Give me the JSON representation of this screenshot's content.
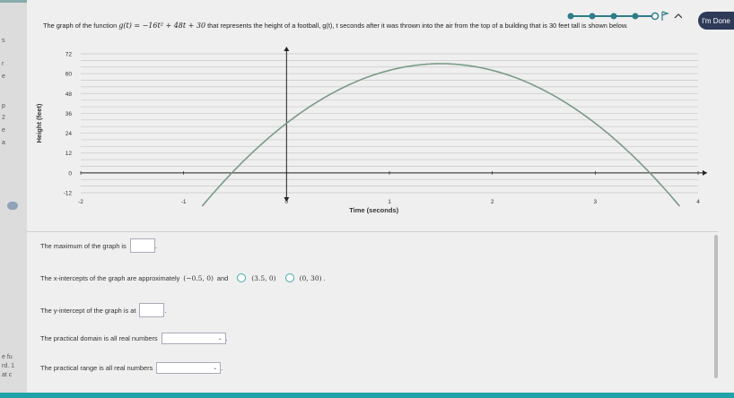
{
  "header": {
    "done_label": "I'm Done"
  },
  "question": {
    "prefix": "The graph of the function ",
    "function": "g(t) = −16t² + 48t + 30",
    "suffix": " that represents the height of a football, g(t), t seconds after it was thrown into the air from the top of a building that is 30 feet tall is shown below."
  },
  "chart_data": {
    "type": "line",
    "xlabel": "Time (seconds)",
    "ylabel": "Height (feet)",
    "xlim": [
      -2,
      4
    ],
    "ylim": [
      -12,
      72
    ],
    "x_ticks": [
      "-2",
      "-1",
      "0",
      "1",
      "2",
      "3",
      "4"
    ],
    "y_ticks": [
      "-12",
      "0",
      "12",
      "24",
      "36",
      "48",
      "60",
      "72"
    ],
    "grid": true,
    "series": [
      {
        "x": [
          -0.55,
          -0.5,
          0,
          0.5,
          1,
          1.5,
          2,
          2.5,
          3,
          3.5,
          3.55
        ],
        "values": [
          -1.24,
          0,
          30,
          50,
          62,
          66,
          62,
          50,
          30,
          0,
          -1.24
        ]
      }
    ]
  },
  "items": {
    "max_text": "The maximum of the graph is",
    "xint_text": "The x-intercepts of the graph are approximately",
    "xint_pt1": "(−0.5, 0)",
    "and": "and",
    "opt1": "(3.5, 0)",
    "opt2": "(0, 30)",
    "yint_text": "The y-intercept of the graph is at",
    "domain_text": "The practical domain is all real numbers",
    "range_text": "The practical range is all real numbers"
  },
  "left_fragments": [
    "s",
    "r",
    "e",
    "p",
    "2",
    "e",
    "a",
    "e fu",
    "rd. 1",
    "at c"
  ]
}
